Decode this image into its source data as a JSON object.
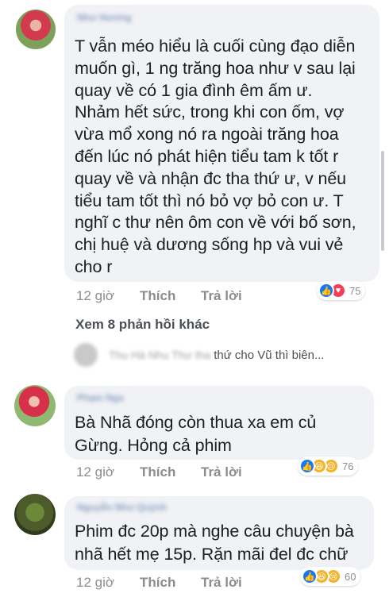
{
  "comments": [
    {
      "author": "Như Hương",
      "lines": [
        "T vẫn méo hiểu là cuối cùng đạo diễn",
        "muốn gì, 1 ng trăng hoa như v sau lại",
        "quay về có 1 gia đình êm ấm ư.",
        "Nhảm hết sức, trong khi con ốm, vợ",
        "vừa mổ xong nó ra ngoài trăng hoa",
        "đến lúc nó phát hiện tiểu tam k tốt r",
        "quay về và nhận đc tha thứ ư, v nếu",
        "tiểu tam tốt thì nó bỏ vợ bỏ con ư. T",
        "nghĩ c thư nên ôm con về với bố sơn,",
        "chị huệ và dương sống hp và vui vẻ",
        "cho r"
      ],
      "time": "12 giờ",
      "like_label": "Thích",
      "reply_label": "Trả lời",
      "reactions": [
        "like",
        "love"
      ],
      "reaction_count": "75"
    },
    {
      "author": "Phạm Nga",
      "lines": [
        "Bà Nhã đóng còn thua xa em củ",
        "Gừng. Hỏng cả phim"
      ],
      "time": "12 giờ",
      "like_label": "Thích",
      "reply_label": "Trả lời",
      "reactions": [
        "like",
        "haha",
        "sad"
      ],
      "reaction_count": "76"
    },
    {
      "author": "Nguyễn Như Quỳnh",
      "lines": [
        "Phim đc 20p mà nghe câu chuyện bà",
        "nhã hết mẹ 15p. Rặn mãi đel đc chữ"
      ],
      "time": "12 giờ",
      "like_label": "Thích",
      "reply_label": "Trả lời",
      "reactions": [
        "like",
        "haha",
        "sad"
      ],
      "reaction_count": "60"
    }
  ],
  "more_replies_label": "Xem 8 phản hồi khác",
  "reply_preview": {
    "name": "Thu Hà Nhu Thư tha",
    "text": "thứ cho Vũ thì biên..."
  },
  "icons": {
    "like": "thumbs-up-icon",
    "love": "heart-icon",
    "haha": "laughing-face-icon",
    "sad": "crying-face-icon"
  },
  "colors": {
    "bubble": "#f0f2f5",
    "meta_text": "#8a8d91",
    "like_blue": "#1877f2",
    "love_red": "#f33e58",
    "emoji_yellow": "#f7b125"
  }
}
